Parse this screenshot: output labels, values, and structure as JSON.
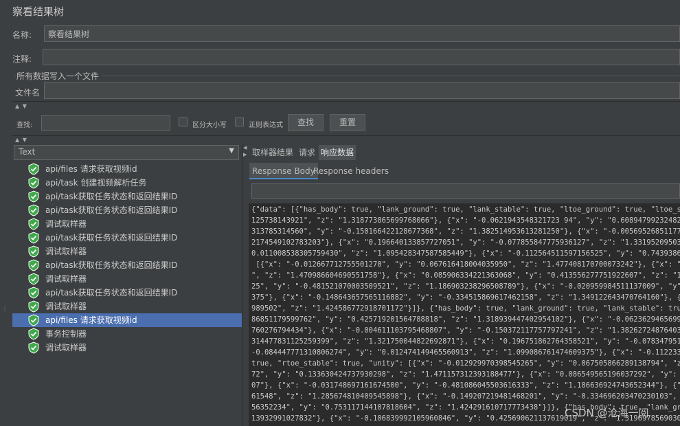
{
  "panel_title": "察看结果树",
  "name": {
    "label": "名称:",
    "value": "察看结果树"
  },
  "comment": {
    "label": "注释:",
    "value": ""
  },
  "file_group": {
    "title": "所有数据写入一个文件",
    "filename_label": "文件名",
    "filename_value": ""
  },
  "search": {
    "label": "查找:",
    "value": "",
    "case_sensitive_label": "区分大小写",
    "regex_label": "正则表达式",
    "find_button": "查找",
    "reset_button": "重置"
  },
  "renderer_combo": {
    "selected": "Text"
  },
  "tree_items": [
    {
      "label": "api/files 请求获取视频id",
      "selected": false
    },
    {
      "label": "api/task 创建视频解析任务",
      "selected": false
    },
    {
      "label": "api/task获取任务状态和返回结果ID",
      "selected": false
    },
    {
      "label": "api/task获取任务状态和返回结果ID",
      "selected": false
    },
    {
      "label": "调试取样器",
      "selected": false
    },
    {
      "label": "api/task获取任务状态和返回结果ID",
      "selected": false
    },
    {
      "label": "调试取样器",
      "selected": false
    },
    {
      "label": "api/task获取任务状态和返回结果ID",
      "selected": false
    },
    {
      "label": "调试取样器",
      "selected": false
    },
    {
      "label": "api/task获取任务状态和返回结果ID",
      "selected": false
    },
    {
      "label": "调试取样器",
      "selected": false
    },
    {
      "label": "api/files 请求获取视频id",
      "selected": true
    },
    {
      "label": "事务控制器",
      "selected": false
    },
    {
      "label": "调试取样器",
      "selected": false
    }
  ],
  "tabs": [
    "取样器结果",
    "请求",
    "响应数据"
  ],
  "active_tab": "响应数据",
  "subtabs": [
    "Response Body",
    "Response headers"
  ],
  "active_subtab": "Response Body",
  "response_lines": [
    "{\"data\": [{\"has_body\": true, \"lank_ground\": true, \"lank_stable\": true, \"ltoe_ground\": true, \"ltoe_stable\": true, \"rank_ground",
    "125738143921\", \"z\": \"1.318773865699768066\"}, {\"x\": \"-0.0621943548321723 94\", \"y\": \"0.608947992324829102\", \"z\": \"1.61154",
    "313785314560\", \"y\": \"-0.150166422128677368\", \"z\": \"1.382514953613281250\"}, {\"x\": \"-0.005695268511772156\", \"y\": \"-0.401",
    "2174549102783203\"}, {\"x\": \"0.196640133857727051\", \"y\": \"-0.077855847775936127\", \"z\": \"1.331952095031738281\"}, {\"x\": \"0",
    "0.011008538305759430\", \"z\": \"1.095428347587585449\"}, {\"x\": \"-0.112564511597156525\", \"y\": \"0.743938684463500977\", \"z\":",
    " [{\"x\": \"-0.012667712755501270\", \"y\": \"0.067616418004035950\", \"z\": \"1.477408170700073242\"}, {\"x\": \"-0.1079402118921279",
    "\", \"z\": \"1.470986604690551758\"}, {\"x\": \"0.085906334221363068\", \"y\": \"0.413556277751922607\", \"z\": \"1.27724599838256835",
    "25\", \"y\": \"-0.481521070003509521\", \"z\": \"1.186903238296508789\"}, {\"x\": \"-0.020959984511137009\", \"y\": \"-0.62830606908317",
    "375\"}, {\"x\": \"-0.148643657565116882\", \"y\": \"-0.334515869617462158\", \"z\": \"1.349122643470764160\"}, {\"x\": \"-0.17157869040",
    "989502\", \"z\": \"1.424586772918701172\"}]}, {\"has_body\": true, \"lank_ground\": true, \"lank_stable\": true, \"ltoe_ground\": true,",
    "86851179599762\", \"y\": \"0.425719201564788818\", \"z\": \"1.318939447402954102\"}, {\"x\": \"-0.062362946569919586\", \"y\": \"0.609",
    "760276794434\"}, {\"x\": \"-0.004611103795468807\", \"y\": \"-0.150372117757797241\", \"z\": \"1.382627248764038086\"}, {\"x\": \"-0.00",
    "314477831125259399\", \"z\": \"1.321750044822692871\"}, {\"x\": \"0.196751862764358521\", \"y\": \"-0.078347951173782349\", \"z\": \"1",
    "-0.084447771310806274\", \"y\": \"0.012474149465560913\", \"z\": \"1.099086761474609375\"}, {\"x\": \"-0.112233616411685944\", \"y\":",
    "true, \"rtoe_stable\": true, \"unity\": [{\"x\": \"-0.012929970398545265\", \"y\": \"0.067505866289138794\", \"z\": \"1.477663397789001",
    "72\", \"y\": \"0.133630424737930298\", \"z\": \"1.471157312393188477\"}, {\"x\": \"0.086549565196037292\", \"y\": \"0.4134873151779174",
    "07\"}, {\"x\": \"-0.031748697161674500\", \"y\": \"-0.481086045503616333\", \"z\": \"1.186636924743652344\"}, {\"x\": \"-0.02045446075",
    "61548\", \"z\": \"1.285674810409545898\"}, {\"x\": \"-0.149207219481468201\", \"y\": \"-0.334696203470230103\", \"z\": \"1.35003316402",
    "56352234\", \"y\": \"0.753117144107818604\", \"z\": \"1.424291610717773438\"}]}, {\"has_body\": true, \"lank_ground\": true, \"lank_s",
    "13932991027832\"}, {\"x\": \"-0.106839992105960846\", \"y\": \"0.425690621137619019\", \"z\": \"1.319697856903076172\"}, {\"x\": \"-0.0"
  ],
  "watermark": "CSDN @沧海一阅",
  "colors": {
    "background": "#3c3f41",
    "selection": "#4b6eaf",
    "field": "#45494a",
    "shield_green": "#3fa94a"
  }
}
